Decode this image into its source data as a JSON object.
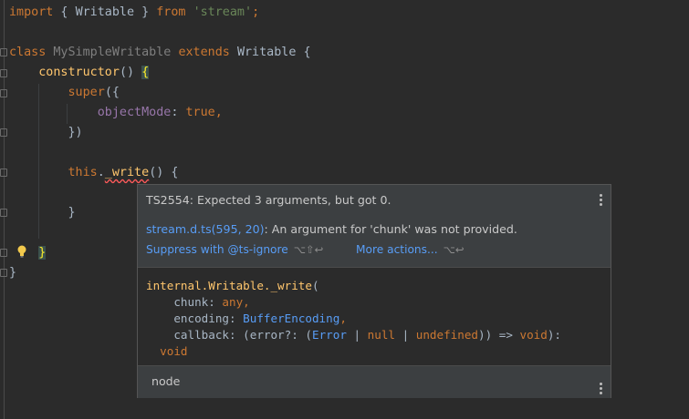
{
  "code": {
    "l1": {
      "kw1": "import",
      "b1": " { ",
      "cls": "Writable",
      "b2": " } ",
      "kw2": "from",
      "sp": " ",
      "str": "'stream'",
      "semi": ";"
    },
    "l3": {
      "kw1": "class",
      "sp1": " ",
      "name": "MySimpleWritable",
      "sp2": " ",
      "kw2": "extends",
      "sp3": " ",
      "cls": "Writable",
      "brace": " {"
    },
    "l4": {
      "indent": "    ",
      "fn": "constructor",
      "paren": "() ",
      "brace": "{"
    },
    "l5": {
      "indent": "        ",
      "kw": "super",
      "rest": "({"
    },
    "l6": {
      "indent": "            ",
      "prop": "objectMode",
      "colon": ": ",
      "kw": "true",
      "comma": ","
    },
    "l7": {
      "indent": "        ",
      "text": "})"
    },
    "l9": {
      "indent": "        ",
      "kw": "this",
      "dot": ".",
      "fn": "_write",
      "rest": "() {"
    },
    "l10": {
      "indent": "        ",
      "text": "}"
    },
    "l12": {
      "indent": "    ",
      "text": "}"
    },
    "l13": {
      "text": "}"
    }
  },
  "popup": {
    "error": "TS2554: Expected 3 arguments, but got 0.",
    "ref_link": "stream.d.ts(595, 20)",
    "ref_text": ": An argument for 'chunk' was not provided.",
    "suppress": "Suppress with @ts-ignore",
    "suppress_shortcut": "⌥⇧↩",
    "more": "More actions...",
    "more_shortcut": "⌥↩",
    "sig": {
      "l1a": "internal.Writable._write",
      "l1b": "(",
      "l2a": "    chunk: ",
      "l2b": "any",
      "l2c": ",",
      "l3a": "    encoding: ",
      "l3b": "BufferEncoding",
      "l3c": ",",
      "l4a": "    callback: (error?: (",
      "l4b": "Error",
      "l4c": " | ",
      "l4d": "null",
      "l4e": " | ",
      "l4f": "undefined",
      "l4g": ")) => ",
      "l4h": "void",
      "l4i": "):",
      "l5": "  void"
    },
    "footer": "node"
  }
}
